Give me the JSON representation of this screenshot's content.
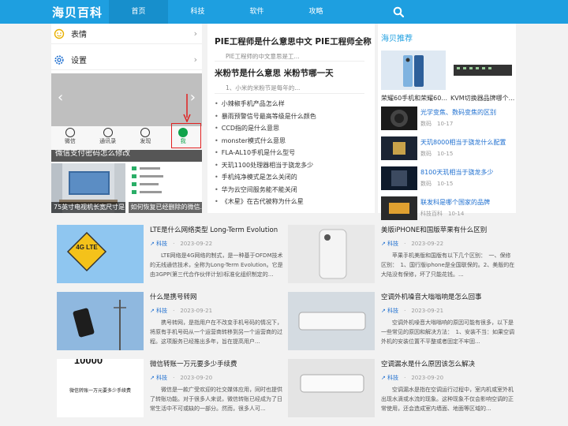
{
  "header": {
    "logo": "海贝百科",
    "nav": [
      "首页",
      "科技",
      "软件",
      "攻略"
    ]
  },
  "left": {
    "settings": [
      {
        "label": "表情",
        "icon": "emoji-icon"
      },
      {
        "label": "设置",
        "icon": "gear-icon"
      }
    ],
    "slider_caption": "微信支付密码怎么修改",
    "phone_tabs": [
      "微信",
      "通讯录",
      "发现",
      "我"
    ],
    "thumbs": [
      {
        "caption": "75英寸电视机长宽尺寸是..."
      },
      {
        "caption": "如何恢复已经删除的微信..."
      }
    ]
  },
  "middle": {
    "featured": [
      {
        "title": "PIE工程师是什么意思中文 PIE工程师全称",
        "summary": "PIE工程师的中文意思是工..."
      },
      {
        "title": "米粉节是什么意思 米粉节哪一天",
        "summary": "1、小米的米粉节是每年的..."
      }
    ],
    "list": [
      "小辣椒手机产品怎么样",
      "暴雨预警信号最高等级是什么颜色",
      "CCD指的是什么意思",
      "monster模式什么意思",
      "FLA-AL10手机是什么型号",
      "天玑1100处理器相当于骁龙多少",
      "手机纯净模式是怎么关闭的",
      "华为云空间服务能不能关闭",
      "《木星》在古代被称为什么星"
    ]
  },
  "right": {
    "title": "海贝推荐",
    "products": [
      {
        "caption": "荣耀60手机和荣耀60..."
      },
      {
        "caption": "KVM切换器品牌哪个..."
      }
    ],
    "items": [
      {
        "title": "光学变焦、数码变焦的区别",
        "category": "数码",
        "date": "10-17"
      },
      {
        "title": "天玑8000相当于骁龙什么配置",
        "category": "数码",
        "date": "10-15"
      },
      {
        "title": "8100天玑相当于骁龙多少",
        "category": "数码",
        "date": "10-15"
      },
      {
        "title": "联发科是哪个国家的品牌",
        "category": "科技百科",
        "date": "10-14"
      }
    ]
  },
  "articles": [
    {
      "title": "LTE是什么网络类型 Long-Term Evolution",
      "category": "科技",
      "date": "2023-09-22",
      "desc": "LTE网络是4G网络的制式，是一种基于OFDM技术的无线通信技术，全称为Long-Term Evolution。它是由3GPP(第三代合作伙伴计划)标准化组织制定的..."
    },
    {
      "title": "美版iPHONE和国版苹果有什么区别",
      "category": "科技",
      "date": "2023-09-22",
      "desc": "苹果手机美版和国版有以下几个区别：　一、保修区别：　1、国行版iphone是全国联保的。2、美版的在大陆没有保修，坏了只能花钱。..."
    },
    {
      "title": "什么是携号转网",
      "category": "科技",
      "date": "2023-09-21",
      "desc": "携号转网，是指用户在不改变手机号码的情况下，将原有手机号码从一个运营商转移到另一个运营商的过程。这项服务已经推出多年，旨在提高用户..."
    },
    {
      "title": "空调外机噪音大嗡嗡响是怎么回事",
      "category": "科技",
      "date": "2023-09-21",
      "desc": "空调外机噪音大嗡嗡响的原因可能有很多，以下是一些常见的原因和解决方法：　1、安装不当：如果空调外机的安装位置不平整或者固定不牢固..."
    },
    {
      "title": "微信转账一万元要多少手续费",
      "category": "科技",
      "date": "2023-09-20",
      "desc": "微信是一款广受欢迎的社交媒体应用，同时也提供了转账功能。对于很多人来说，微信转账已经成为了日常生活中不可或缺的一部分。然而，很多人可..."
    },
    {
      "title": "空调漏水是什么原因该怎么解决",
      "category": "科技",
      "date": "2023-09-20",
      "desc": "空调漏水是指在空调运行过程中，室内机或室外机出现水滴或水流的现象。这种现象不仅会影响空调的正常使用，还会造成室内墙面、地面等区域的..."
    }
  ],
  "image_text": {
    "lte_sign": "4G LTE",
    "wechat_big": "10000",
    "wechat_sub": "微信转账一万元要多少手续费"
  },
  "colors": {
    "brand": "#1e9fe0",
    "link": "#1e6fd0",
    "highlight": "#e02020"
  }
}
